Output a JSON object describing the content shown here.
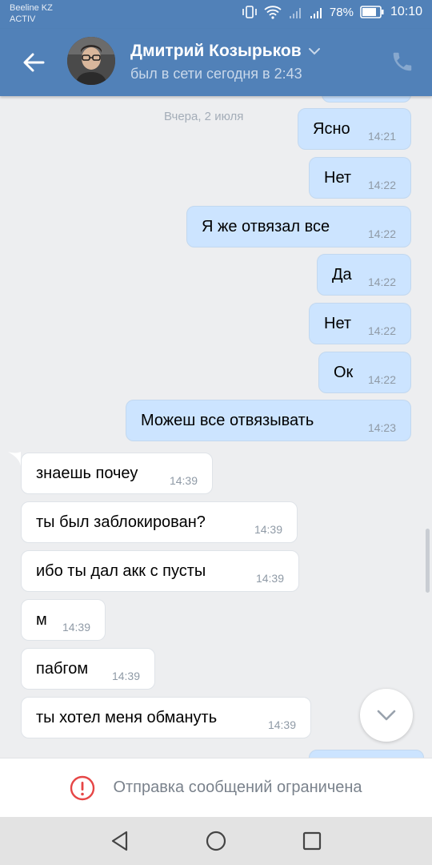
{
  "status_bar": {
    "carrier_line1": "Beeline KZ",
    "carrier_line2": "ACTIV",
    "battery_percent": "78%",
    "time": "10:10"
  },
  "header": {
    "name": "Дмитрий Козырьков",
    "status": "был в сети сегодня в 2:43"
  },
  "chat": {
    "date_separator": "Вчера, 2 июля",
    "messages": [
      {
        "dir": "out",
        "text": "Ясно",
        "time": "14:21"
      },
      {
        "dir": "out",
        "text": "Нет",
        "time": "14:22"
      },
      {
        "dir": "out",
        "text": "Я же отвязал все",
        "time": "14:22"
      },
      {
        "dir": "out",
        "text": "Да",
        "time": "14:22"
      },
      {
        "dir": "out",
        "text": "Нет",
        "time": "14:22"
      },
      {
        "dir": "out",
        "text": "Ок",
        "time": "14:22"
      },
      {
        "dir": "out",
        "text": "Можеш все отвязывать",
        "time": "14:23"
      },
      {
        "dir": "in",
        "text": "знаешь почеу",
        "time": "14:39"
      },
      {
        "dir": "in",
        "text": "ты был заблокирован?",
        "time": "14:39"
      },
      {
        "dir": "in",
        "text": "ибо ты дал акк с пусты",
        "time": "14:39"
      },
      {
        "dir": "in",
        "text": "м",
        "time": "14:39"
      },
      {
        "dir": "in",
        "text": "пабгом",
        "time": "14:39"
      },
      {
        "dir": "in",
        "text": "ты хотел меня обмануть",
        "time": "14:39"
      }
    ]
  },
  "restriction": {
    "text": "Отправка сообщений ограничена"
  },
  "colors": {
    "header": "#5181b8",
    "outgoing_bubble": "#cce4ff",
    "incoming_bubble": "#ffffff",
    "chat_background": "#edeef0",
    "warning_icon": "#e64646"
  },
  "icons": {
    "back": "arrow-left-icon",
    "dropdown": "chevron-down-icon",
    "call": "phone-icon",
    "scroll_down": "chevron-down-icon",
    "warning": "exclamation-circle-icon",
    "nav_back": "triangle-back-icon",
    "nav_home": "circle-home-icon",
    "nav_recent": "square-recent-icon"
  }
}
